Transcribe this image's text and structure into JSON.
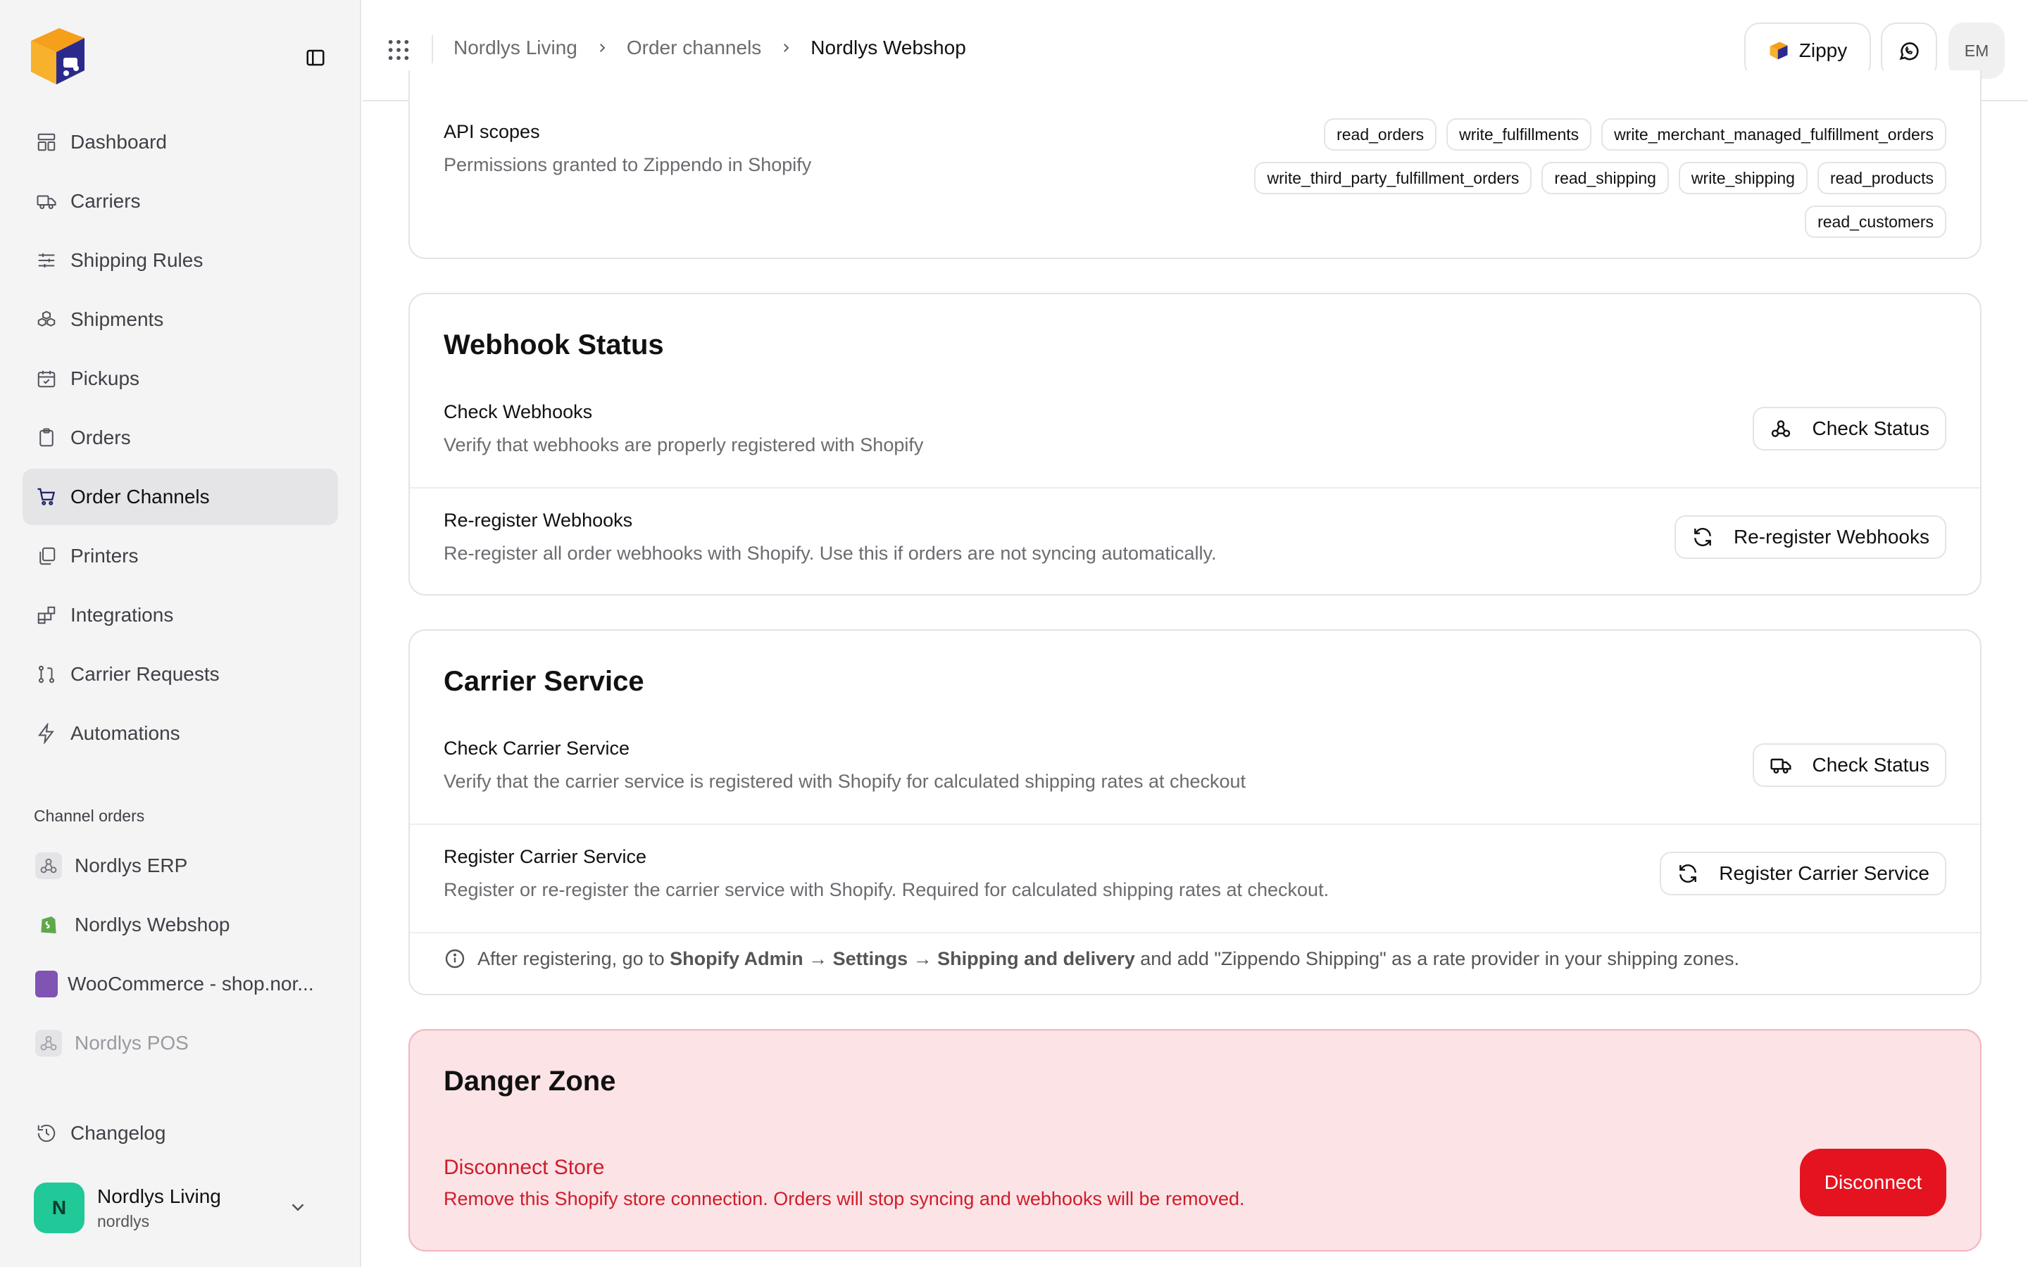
{
  "sidebar": {
    "nav": [
      {
        "label": "Dashboard",
        "icon": "layout-icon"
      },
      {
        "label": "Carriers",
        "icon": "truck-icon"
      },
      {
        "label": "Shipping Rules",
        "icon": "sliders-icon"
      },
      {
        "label": "Shipments",
        "icon": "boxes-icon"
      },
      {
        "label": "Pickups",
        "icon": "calendar-check-icon"
      },
      {
        "label": "Orders",
        "icon": "clipboard-icon"
      },
      {
        "label": "Order Channels",
        "icon": "cart-icon",
        "active": true
      },
      {
        "label": "Printers",
        "icon": "copy-icon"
      },
      {
        "label": "Integrations",
        "icon": "blocks-icon"
      },
      {
        "label": "Carrier Requests",
        "icon": "git-pull-request-icon"
      },
      {
        "label": "Automations",
        "icon": "zap-icon"
      }
    ],
    "section_label": "Channel orders",
    "channels": [
      {
        "label": "Nordlys ERP",
        "icon": "webhook-icon"
      },
      {
        "label": "Nordlys Webshop",
        "icon": "shopify-icon"
      },
      {
        "label": "WooCommerce - shop.nor...",
        "icon": "woocommerce-icon"
      },
      {
        "label": "Nordlys POS",
        "icon": "webhook-icon"
      }
    ],
    "changelog": "Changelog",
    "user": {
      "initial": "N",
      "name": "Nordlys Living",
      "handle": "nordlys"
    }
  },
  "header": {
    "breadcrumbs": [
      "Nordlys Living",
      "Order channels",
      "Nordlys Webshop"
    ],
    "zippy_label": "Zippy",
    "user_initials": "EM"
  },
  "api_scopes": {
    "title": "API scopes",
    "description": "Permissions granted to Zippendo in Shopify",
    "scopes_row1": [
      "read_orders",
      "write_fulfillments",
      "write_merchant_managed_fulfillment_orders"
    ],
    "scopes_row2": [
      "write_third_party_fulfillment_orders",
      "read_shipping",
      "write_shipping",
      "read_products"
    ],
    "scopes_row3": [
      "read_customers"
    ]
  },
  "webhook": {
    "title": "Webhook Status",
    "check": {
      "title": "Check Webhooks",
      "description": "Verify that webhooks are properly registered with Shopify",
      "button": "Check Status"
    },
    "reregister": {
      "title": "Re-register Webhooks",
      "description": "Re-register all order webhooks with Shopify. Use this if orders are not syncing automatically.",
      "button": "Re-register Webhooks"
    }
  },
  "carrier": {
    "title": "Carrier Service",
    "check": {
      "title": "Check Carrier Service",
      "description": "Verify that the carrier service is registered with Shopify for calculated shipping rates at checkout",
      "button": "Check Status"
    },
    "register": {
      "title": "Register Carrier Service",
      "description": "Register or re-register the carrier service with Shopify. Required for calculated shipping rates at checkout.",
      "button": "Register Carrier Service"
    },
    "info": {
      "prefix": "After registering, go to",
      "path": "Shopify Admin → Settings → Shipping and delivery",
      "suffix": "and add \"Zippendo Shipping\" as a rate provider in your shipping zones."
    }
  },
  "danger": {
    "title": "Danger Zone",
    "action_title": "Disconnect Store",
    "action_description": "Remove this Shopify store connection. Orders will stop syncing and webhooks will be removed.",
    "button": "Disconnect"
  },
  "colors": {
    "accent": "#1f1f6b",
    "danger": "#e5131f",
    "danger_bg": "#fbe3e6",
    "brand_orange": "#f59f1b",
    "brand_navy": "#2b2a8c"
  }
}
